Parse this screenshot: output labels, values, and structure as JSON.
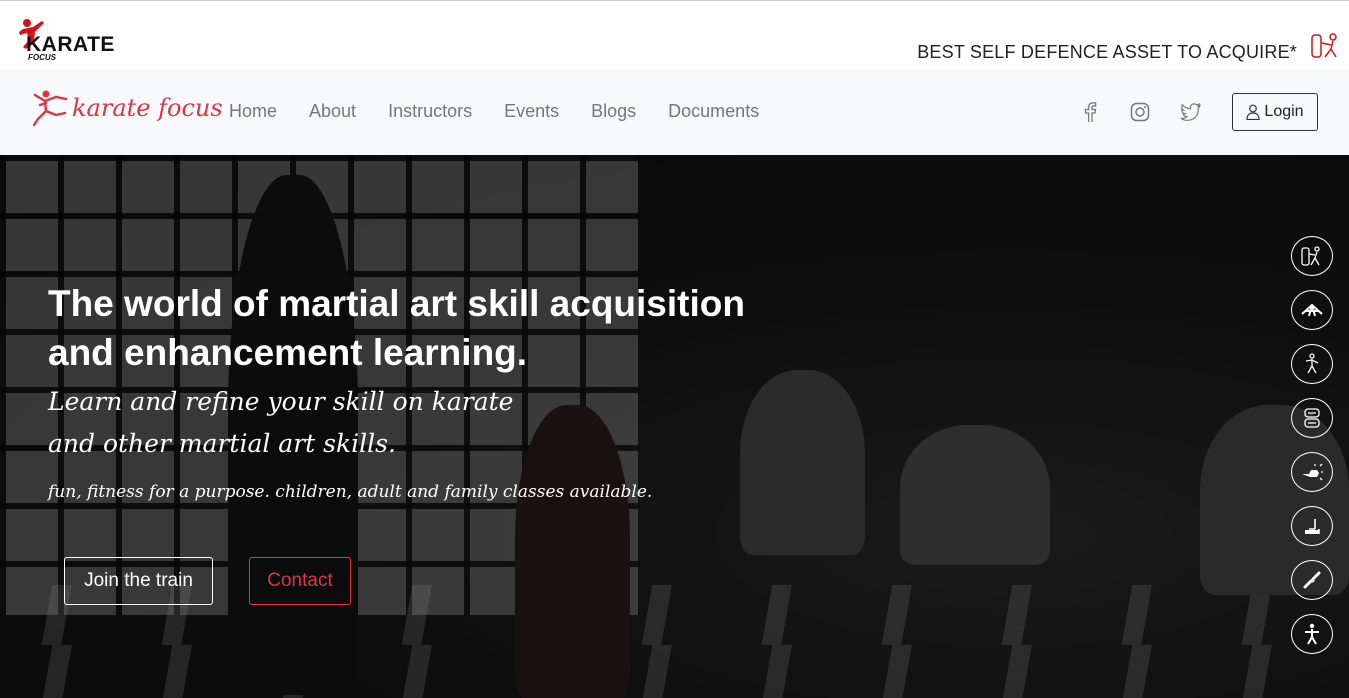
{
  "top": {
    "logo_word": "KARATE",
    "logo_sub": "FOCUS",
    "tagline": "BEST SELF DEFENCE ASSET TO ACQUIRE*"
  },
  "nav": {
    "brand": "karate focus",
    "links": [
      "Home",
      "About",
      "Instructors",
      "Events",
      "Blogs",
      "Documents"
    ],
    "social_icons": [
      "facebook-icon",
      "instagram-icon",
      "twitter-icon"
    ],
    "login_label": "Login"
  },
  "hero": {
    "title_line1": "The world of martial art skill acquisition",
    "title_line2": "and enhancement learning.",
    "sub_line1": "Learn and refine your skill on karate",
    "sub_line2": "and other martial art skills.",
    "note": "fun, fitness for a purpose. children, adult and family classes available.",
    "join_label": "Join the train",
    "contact_label": "Contact",
    "side_icons": [
      "punching-bag-icon",
      "belt-icon",
      "fighter-icon",
      "boxing-gloves-icon",
      "punch-icon",
      "kick-icon",
      "nunchaku-icon",
      "martial-artist-icon"
    ]
  },
  "colors": {
    "accent": "#dc3545",
    "navbar_bg": "#f8f9fa"
  }
}
